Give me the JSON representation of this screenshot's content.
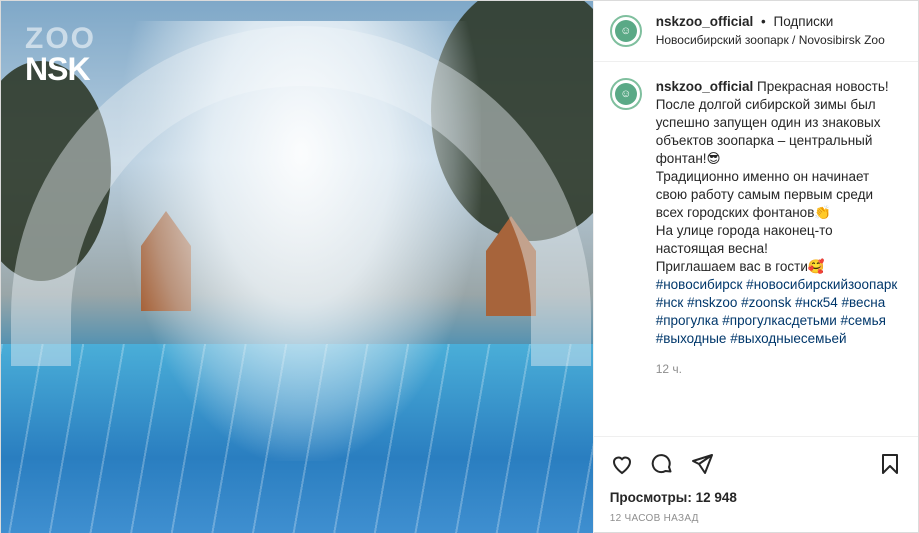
{
  "logo": {
    "line1": "ZOO",
    "line2": "NSK"
  },
  "post": {
    "username": "nskzoo_official",
    "separator": "•",
    "follow_label": "Подписки",
    "location": "Новосибирский зоопарк / Novosibirsk Zoo",
    "caption_lines": [
      "Прекрасная новость! После долгой сибирской зимы был успешно запущен один из знаковых объектов зоопарка – центральный фонтан!😎",
      "Традиционно именно он начинает свою работу самым первым среди всех городских фонтанов👏",
      "На улице города наконец-то настоящая весна!",
      "Приглашаем вас в гости🥰"
    ],
    "hashtags": "#новосибирск #новосибирскийзоопарк #нск #nskzoo #zoonsk #нск54 #весна #прогулка #прогулкасдетьми #семья #выходные #выходныесемьей",
    "time_short": "12 ч.",
    "views_label": "Просмотры:",
    "views_count": "12 948",
    "time_long": "12 ЧАСОВ НАЗАД"
  },
  "icons": [
    "heart-icon",
    "comment-icon",
    "share-icon",
    "bookmark-icon"
  ]
}
